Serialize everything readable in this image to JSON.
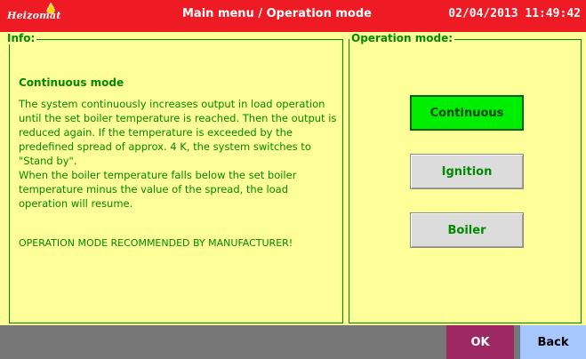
{
  "header": {
    "logo_text": "Heizomat",
    "title": "Main menu / Operation mode",
    "datetime": "02/04/2013 11:49:42"
  },
  "info_panel": {
    "label": "Info:",
    "heading": "Continuous mode",
    "paragraphs": [
      "The system continuously increases output in load operation until the set boiler temperature is reached. Then the output is reduced again. If the temperature is exceeded by the predefined spread of approx. 4 K, the system switches to \"Stand by\".",
      "When the boiler temperature falls below the set boiler temperature minus the value of the spread, the load operation will resume."
    ],
    "recommendation": "OPERATION MODE RECOMMENDED BY MANUFACTURER!"
  },
  "mode_panel": {
    "label": "Operation mode:",
    "options": [
      {
        "label": "Continuous",
        "selected": true
      },
      {
        "label": "Ignition",
        "selected": false
      },
      {
        "label": "Boiler",
        "selected": false
      }
    ]
  },
  "footer": {
    "ok_label": "OK",
    "back_label": "Back"
  },
  "colors": {
    "header_red": "#ee1b24",
    "background_yellow": "#ffff99",
    "text_green": "#008a00",
    "selected_green": "#00ee00",
    "ok_purple": "#9e2862",
    "back_blue": "#a6c8ff",
    "footer_gray": "#777777"
  }
}
